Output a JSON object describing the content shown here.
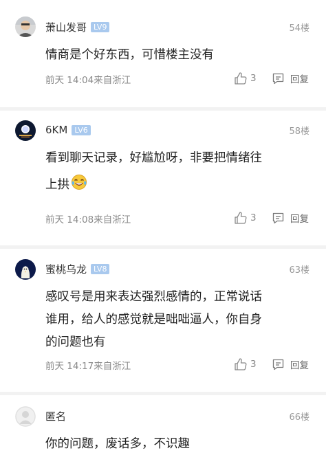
{
  "comments": [
    {
      "username": "萧山发哥",
      "level": "LV9",
      "floor": "54楼",
      "lines": [
        "情商是个好东西，可惜楼主没有"
      ],
      "time_location": "前天 14:04来自浙江",
      "likes": "3",
      "reply_label": "回复"
    },
    {
      "username": "6KM",
      "level": "LV6",
      "floor": "58楼",
      "lines": [
        "看到聊天记录，好尴尬呀，非要把情绪往",
        "上拱"
      ],
      "emoji": "laughing-with-tears",
      "time_location": "前天 14:08来自浙江",
      "likes": "3",
      "reply_label": "回复"
    },
    {
      "username": "蜜桃乌龙",
      "level": "LV8",
      "floor": "63楼",
      "lines": [
        "感叹号是用来表达强烈感情的，正常说话",
        "谁用，给人的感觉就是咄咄逼人，你自身",
        "的问题也有"
      ],
      "time_location": "前天 14:17来自浙江",
      "likes": "3",
      "reply_label": "回复"
    },
    {
      "username": "匿名",
      "floor": "66楼",
      "lines": [
        "你的问题，废话多，不识趣"
      ]
    }
  ],
  "colors": {
    "level_badge": "#a9c9ee",
    "separator": "#f2f2f2",
    "meta_text": "#8a8a8a"
  }
}
